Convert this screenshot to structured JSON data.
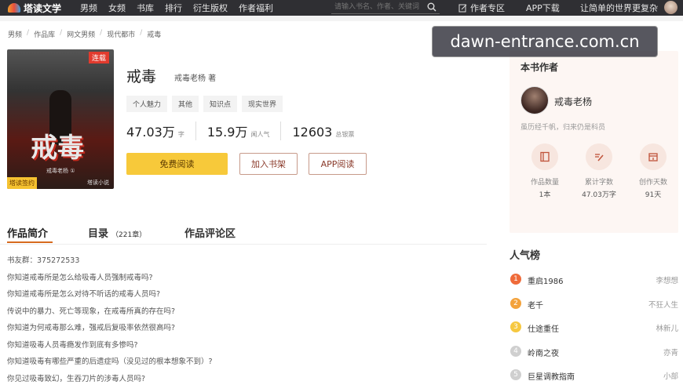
{
  "topbar": {
    "logo": "塔读文学",
    "nav": [
      "男频",
      "女频",
      "书库",
      "排行",
      "衍生版权",
      "作者福利"
    ],
    "search_placeholder": "请输入书名、作者、关键词",
    "author_zone": "作者专区",
    "app_download": "APP下载",
    "username": "让简单的世界更复杂"
  },
  "breadcrumb": [
    "男频",
    "作品库",
    "网文男频",
    "现代都市",
    "戒毒"
  ],
  "cover": {
    "badge_top": "连载",
    "title_art": "戒毒",
    "subtitle": "戒毒老杨 ①",
    "badge_bottom": "塔读签约",
    "publisher": "塔读小说"
  },
  "book": {
    "title": "戒毒",
    "author_line": "戒毒老杨 著",
    "tags": [
      "个人魅力",
      "其他",
      "知识点",
      "现实世界"
    ],
    "stats": [
      {
        "num": "47.03万",
        "label": "字"
      },
      {
        "num": "15.9万",
        "label": "闻人气"
      },
      {
        "num": "12603",
        "label": "总银票"
      }
    ],
    "read_btn": "免费阅读",
    "shelf_btn": "加入书架",
    "app_btn": "APP阅读"
  },
  "author_card": {
    "heading": "本书作者",
    "name": "戒毒老杨",
    "desc": "虽历经千帆，归来仍是科员",
    "stats": [
      {
        "label": "作品数量",
        "value": "1本"
      },
      {
        "label": "累计字数",
        "value": "47.03万字"
      },
      {
        "label": "创作天数",
        "value": "91天"
      }
    ]
  },
  "tabs": {
    "intro": "作品简介",
    "toc": "目录",
    "toc_count": "（221章）",
    "review": "作品评论区"
  },
  "intro_lines": [
    "书友群：375272533",
    "你知道戒毒所是怎么给吸毒人员强制戒毒吗?",
    "你知道戒毒所是怎么对待不听话的戒毒人员吗?",
    "传说中的暴力、死亡等现象，在戒毒所真的存在吗?",
    "你知道为何戒毒那么难，强戒后复吸率依然很高吗?",
    "你知道吸毒人员毒瘾发作到底有多惨吗?",
    "你知道吸毒有哪些严重的后遗症吗（没见过的根本想象不到）?",
    "你见过吸毒致幻，生吞刀片的涉毒人员吗?"
  ],
  "ranking": {
    "heading": "人气榜",
    "items": [
      {
        "rank": "1",
        "book": "重启1986",
        "author": "李想想",
        "color": "#ef6b3a"
      },
      {
        "rank": "2",
        "book": "老千",
        "author": "不狂人生",
        "color": "#f3a23c"
      },
      {
        "rank": "3",
        "book": "仕途重任",
        "author": "林新儿",
        "color": "#f6c840"
      },
      {
        "rank": "4",
        "book": "岭南之夜",
        "author": "亦青",
        "color": "#cfcfcf"
      },
      {
        "rank": "5",
        "book": "巨星调教指南",
        "author": "小部",
        "color": "#cfcfcf"
      }
    ]
  },
  "watermark": "dawn-entrance.com.cn"
}
